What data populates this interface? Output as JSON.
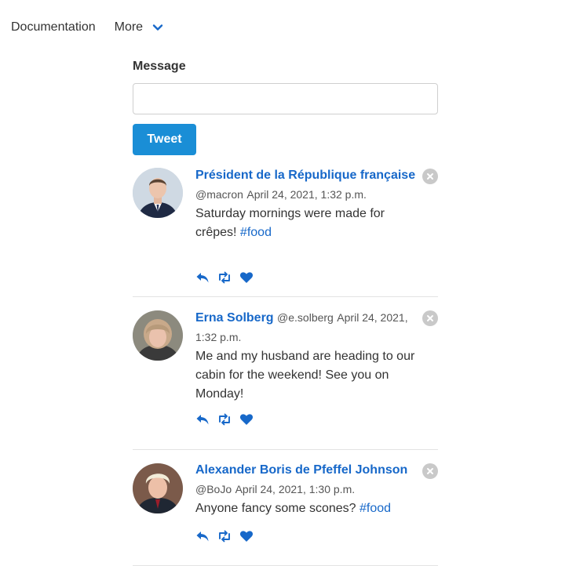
{
  "nav": {
    "documentation": "Documentation",
    "more": "More"
  },
  "form": {
    "message_label": "Message",
    "message_value": "",
    "tweet_button": "Tweet"
  },
  "tweets": [
    {
      "name": "Président de la République française",
      "handle": "@macron",
      "timestamp": "April 24, 2021, 1:32 p.m.",
      "text": "Saturday mornings were made for crêpes! ",
      "hashtag": "#food"
    },
    {
      "name": "Erna Solberg",
      "handle": "@e.solberg",
      "timestamp": "April 24, 2021, 1:32 p.m.",
      "text": "Me and my husband are heading to our cabin for the weekend! See you on Monday!",
      "hashtag": ""
    },
    {
      "name": "Alexander Boris de Pfeffel Johnson",
      "handle": "@BoJo",
      "timestamp": "April 24, 2021, 1:30 p.m.",
      "text": "Anyone fancy some scones? ",
      "hashtag": "#food"
    }
  ],
  "icons": {
    "nav_more": "chevron-down-icon",
    "reply": "reply-icon",
    "retweet": "retweet-icon",
    "like": "heart-icon",
    "delete": "close-circle-icon"
  },
  "colors": {
    "accent": "#1a8ed6",
    "link": "#1768c9",
    "icon": "#1768c9",
    "close_bg": "#c9c9c9",
    "divider": "#e3e3e3"
  }
}
